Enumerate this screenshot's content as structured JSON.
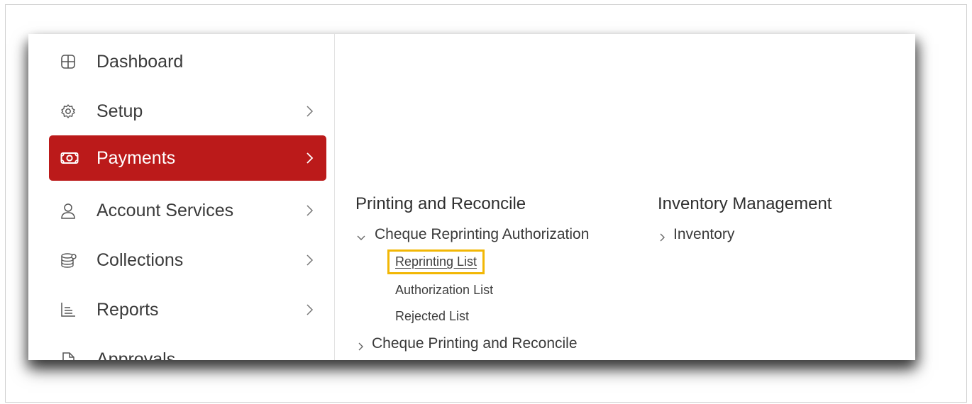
{
  "sidebar": {
    "items": [
      {
        "label": "Dashboard",
        "icon": "grid-icon",
        "has_chevron": false
      },
      {
        "label": "Setup",
        "icon": "gear-icon",
        "has_chevron": true
      },
      {
        "label": "Payments",
        "icon": "money-icon",
        "has_chevron": true,
        "active": true
      },
      {
        "label": "Account Services",
        "icon": "person-icon",
        "has_chevron": true
      },
      {
        "label": "Collections",
        "icon": "coins-icon",
        "has_chevron": true
      },
      {
        "label": "Reports",
        "icon": "chart-icon",
        "has_chevron": true
      },
      {
        "label": "Approvals",
        "icon": "document-icon",
        "has_chevron": false
      }
    ]
  },
  "menu": {
    "col1": {
      "title": "Printing and Reconcile",
      "group1": {
        "label": "Cheque Reprinting Authorization",
        "expanded": true,
        "items": [
          "Reprinting List",
          "Authorization List",
          "Rejected List"
        ]
      },
      "group2": {
        "label": "Cheque Printing and Reconcile",
        "expanded": false
      }
    },
    "col2": {
      "title": "Inventory Management",
      "group1": {
        "label": "Inventory",
        "expanded": false
      }
    }
  },
  "colors": {
    "active_bg": "#bb1a1a",
    "highlight_outline": "#f2b705"
  }
}
